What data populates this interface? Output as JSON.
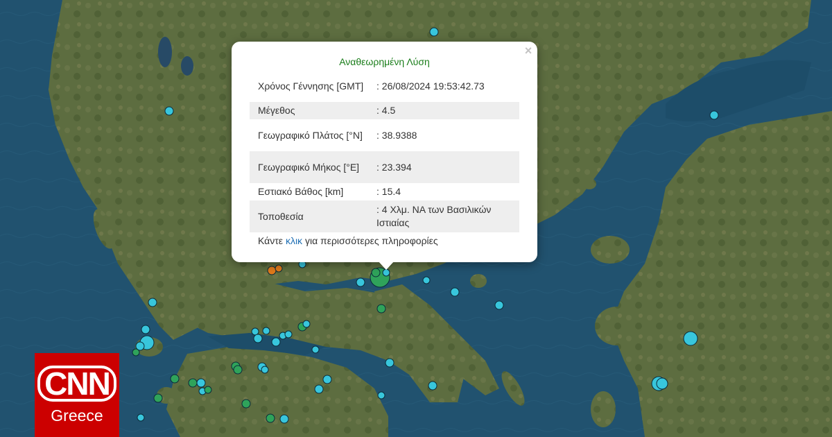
{
  "popup": {
    "title": "Αναθεωρημένη Λύση",
    "close": "×",
    "rows": [
      {
        "label": "Χρόνος Γέννησης [GMT]",
        "value": ": 26/08/2024 19:53:42.73"
      },
      {
        "label": "Μέγεθος",
        "value": ": 4.5"
      },
      {
        "label": "Γεωγραφικό Πλάτος [°N]",
        "value": ": 38.9388"
      },
      {
        "label": "Γεωγραφικό Μήκος [°E]",
        "value": ": 23.394"
      },
      {
        "label": "Εστιακό Βάθος [km]",
        "value": ": 15.4"
      },
      {
        "label": "Τοποθεσία",
        "value": ": 4 Χλμ. ΝΑ των Βασιλικών Ιστιαίας"
      }
    ],
    "more_prefix": "Κάντε",
    "more_link": "κλικ",
    "more_suffix": "για περισσότερες πληροφορίες"
  },
  "logo": {
    "main": "CNN",
    "sub": "Greece"
  },
  "colors": {
    "sea": "#21526f",
    "land": "#5a6b3f",
    "marker_cyan": "#38c6dc",
    "marker_green": "#2fa35a",
    "marker_orange": "#e07a1a",
    "logo_red": "#cc0000",
    "title_green": "#1a7d1a"
  }
}
